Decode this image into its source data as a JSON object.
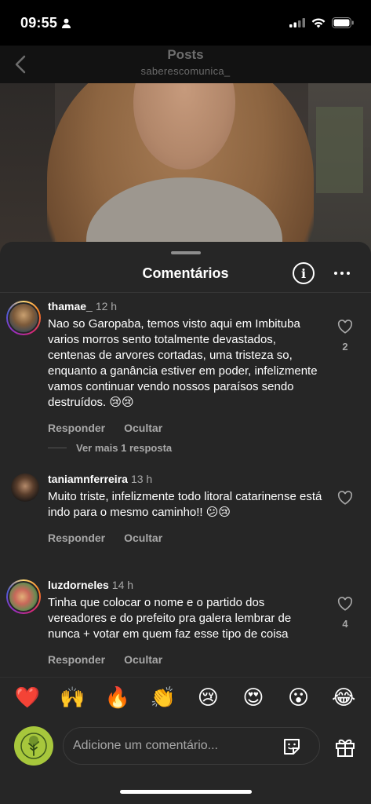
{
  "status_bar": {
    "time": "09:55"
  },
  "header": {
    "title": "Posts",
    "subtitle": "saberescomunica_"
  },
  "sheet": {
    "title": "Comentários"
  },
  "comments": [
    {
      "username": "thamae_",
      "time": "12 h",
      "text": "Nao so Garopaba, temos visto aqui em Imbituba varios morros sento totalmente devastados, centenas de arvores cortadas, uma tristeza so, enquanto a ganância estiver em poder, infelizmente vamos continuar vendo nossos paraísos sendo destruídos. 😢😢",
      "likes": "2",
      "reply_label": "Responder",
      "hide_label": "Ocultar",
      "more_replies": "Ver mais 1 resposta"
    },
    {
      "username": "taniamnferreira",
      "time": "13 h",
      "text": "Muito triste, infelizmente todo litoral catarinense está indo para o mesmo caminho!! 😕😢",
      "likes": "",
      "reply_label": "Responder",
      "hide_label": "Ocultar"
    },
    {
      "username": "luzdorneles",
      "time": "14 h",
      "text": "Tinha que colocar o nome e o partido dos vereadores e do prefeito pra galera lembrar de nunca + votar em quem faz esse tipo de coisa",
      "likes": "4",
      "reply_label": "Responder",
      "hide_label": "Ocultar"
    }
  ],
  "reactions": [
    "❤️",
    "🙌",
    "🔥",
    "👏",
    "😢",
    "😍",
    "😮",
    "😂"
  ],
  "input": {
    "placeholder": "Adicione um comentário..."
  },
  "colors": {
    "sheet_bg": "#262626",
    "muted": "#a8a8a8",
    "my_avatar_bg": "#a7c73c"
  },
  "icons": [
    "person-icon",
    "signal-icon",
    "wifi-icon",
    "battery-icon",
    "back-chevron-icon",
    "info-icon",
    "more-icon",
    "heart-icon",
    "sticker-icon",
    "gift-icon"
  ]
}
